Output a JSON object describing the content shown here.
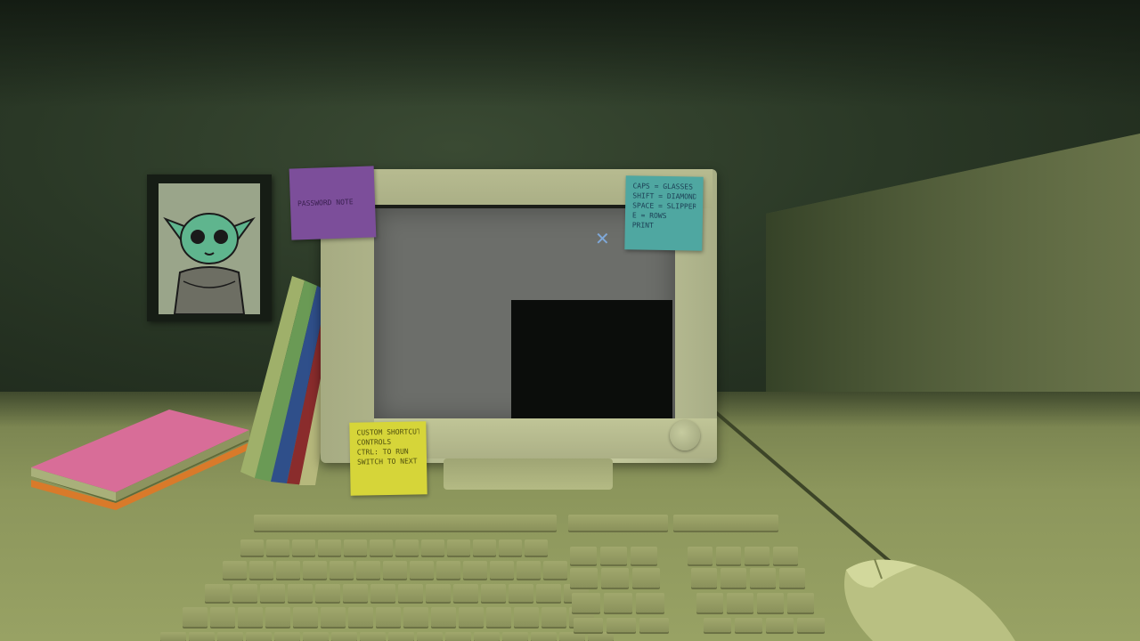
{
  "scene": {
    "description_type": "first-person 3D office cubicle"
  },
  "notes": {
    "purple": [
      "PASSWORD NOTE"
    ],
    "cyan": [
      "CAPS = GLASSES",
      "SHIFT = DIAMOND",
      "SPACE = SLIPPER",
      "E = ROWS",
      "PRINT"
    ],
    "yellow": [
      "CUSTOM SHORTCUT",
      "CONTROLS",
      "CTRL: TO RUN",
      "SWITCH TO NEXT LINE"
    ]
  },
  "colors": {
    "wall": "#2a3826",
    "desk": "#8c965c",
    "monitor": "#b8bd92",
    "screen": "#6c6e6a",
    "note_purple": "#7c4e9a",
    "note_cyan": "#4fa7a1",
    "note_yellow": "#d6d539"
  },
  "icons": {
    "cursor": "cursor-icon",
    "poster": "alien-baby-portrait"
  }
}
